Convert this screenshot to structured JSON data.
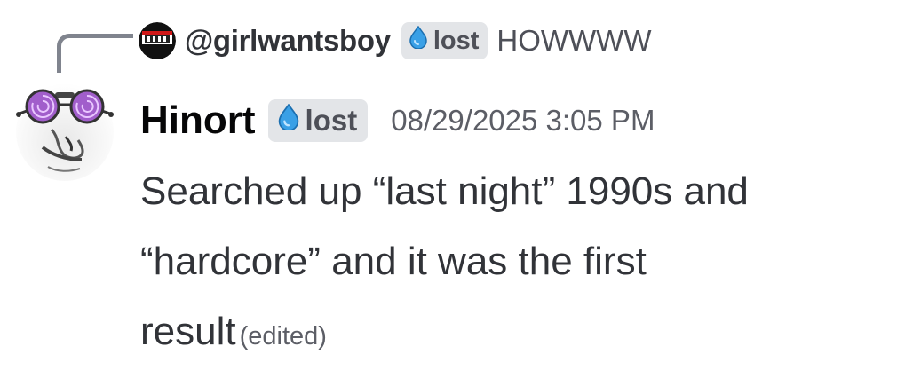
{
  "reply": {
    "author": "@girlwantsboy",
    "tag_label": "lost",
    "tag_icon": "water-drop-icon",
    "text": "HOWWWW"
  },
  "message": {
    "author": "Hinort",
    "tag_label": "lost",
    "tag_icon": "water-drop-icon",
    "timestamp": "08/29/2025 3:05 PM",
    "lines": [
      "Searched up “last night” 1990s and",
      "“hardcore” and it was the first",
      "result"
    ],
    "edited": "(edited)"
  },
  "colors": {
    "accent_drop": "#3aa0e6",
    "tag_bg": "#e3e5e8",
    "spine": "#80848e"
  }
}
